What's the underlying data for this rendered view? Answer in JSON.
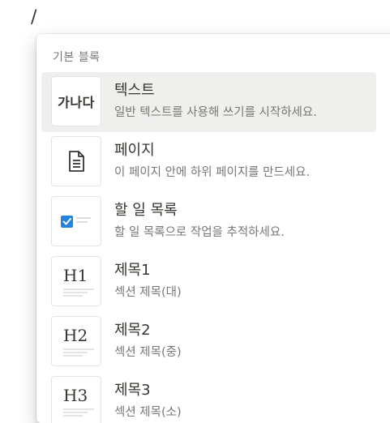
{
  "editor": {
    "slash_text": "/"
  },
  "menu": {
    "section_header": "기본 블록",
    "items": [
      {
        "title": "텍스트",
        "description": "일반 텍스트를 사용해 쓰기를 시작하세요.",
        "thumb_text": "가나다",
        "icon": "text-block-icon",
        "selected": true
      },
      {
        "title": "페이지",
        "description": "이 페이지 안에 하위 페이지를 만드세요.",
        "icon": "page-document-icon",
        "selected": false
      },
      {
        "title": "할 일 목록",
        "description": "할 일 목록으로 작업을 추적하세요.",
        "icon": "todo-checkbox-icon",
        "selected": false
      },
      {
        "title": "제목1",
        "description": "섹션 제목(대)",
        "thumb_text": "H1",
        "icon": "heading-1-icon",
        "selected": false
      },
      {
        "title": "제목2",
        "description": "섹션 제목(중)",
        "thumb_text": "H2",
        "icon": "heading-2-icon",
        "selected": false
      },
      {
        "title": "제목3",
        "description": "섹션 제목(소)",
        "thumb_text": "H3",
        "icon": "heading-3-icon",
        "selected": false
      }
    ]
  },
  "colors": {
    "text_primary": "#37352f",
    "text_secondary": "#787774",
    "selected_bg": "#efefee",
    "checkbox_blue": "#2383e2"
  }
}
